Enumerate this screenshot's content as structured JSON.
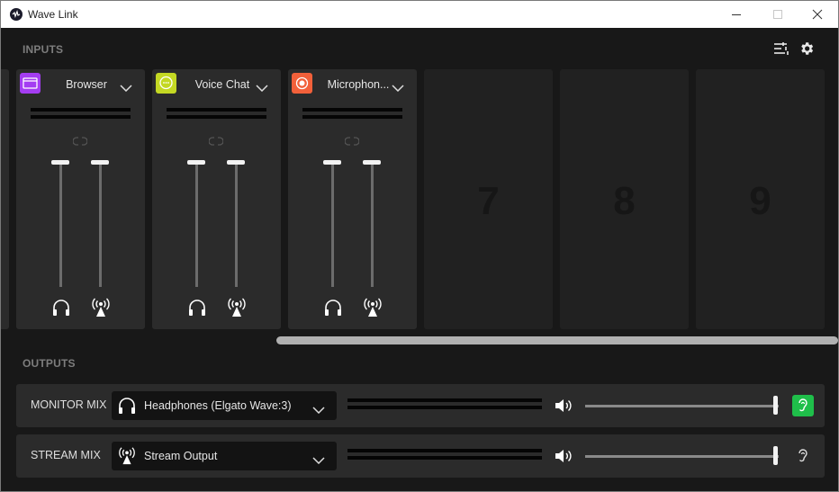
{
  "window": {
    "title": "Wave Link"
  },
  "inputs": {
    "section_label": "INPUTS",
    "channels": [
      {
        "name": "Browser",
        "icon": "browser-window-icon",
        "color": "#a43df2"
      },
      {
        "name": "Voice Chat",
        "icon": "chat-bubble-icon",
        "color": "#c4d823"
      },
      {
        "name": "Microphon...",
        "icon": "record-icon",
        "color": "#f2603a"
      }
    ],
    "empty_slots": [
      "7",
      "8",
      "9"
    ]
  },
  "outputs": {
    "section_label": "OUTPUTS",
    "mixes": [
      {
        "label": "MONITOR MIX",
        "device": "Headphones (Elgato Wave:3)",
        "device_icon": "headphones-icon",
        "volume": 1.0,
        "monitoring": true,
        "monitor_color": "#1fbf4a"
      },
      {
        "label": "STREAM MIX",
        "device": "Stream Output",
        "device_icon": "broadcast-icon",
        "volume": 1.0,
        "monitoring": false
      }
    ]
  },
  "colors": {
    "background": "#181818",
    "strip": "#2b2b2b",
    "empty_slot": "#212121"
  }
}
